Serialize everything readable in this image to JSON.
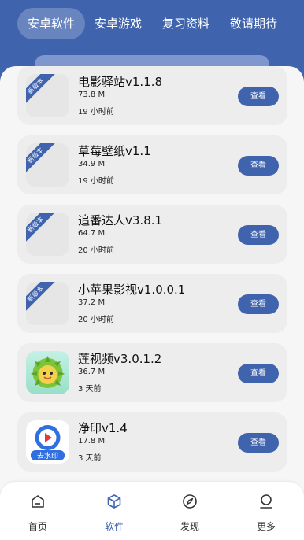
{
  "top_tabs": [
    {
      "label": "安卓软件",
      "active": true
    },
    {
      "label": "安卓游戏",
      "active": false
    },
    {
      "label": "复习资料",
      "active": false
    },
    {
      "label": "敬请期待",
      "active": false
    }
  ],
  "apps": [
    {
      "name": "电影驿站v1.1.8",
      "size": "73.8 M",
      "time": "19 小时前",
      "badge": "新版本",
      "button": "查看",
      "icon": "placeholder"
    },
    {
      "name": "草莓壁纸v1.1",
      "size": "34.9 M",
      "time": "19 小时前",
      "badge": "新版本",
      "button": "查看",
      "icon": "placeholder"
    },
    {
      "name": "追番达人v3.8.1",
      "size": "64.7 M",
      "time": "20 小时前",
      "badge": "新版本",
      "button": "查看",
      "icon": "placeholder"
    },
    {
      "name": "小苹果影视v1.0.0.1",
      "size": "37.2 M",
      "time": "20 小时前",
      "badge": "新版本",
      "button": "查看",
      "icon": "placeholder"
    },
    {
      "name": "莲视频v3.0.1.2",
      "size": "36.7 M",
      "time": "3 天前",
      "button": "查看",
      "icon": "lianshipin-icon"
    },
    {
      "name": "净印v1.4",
      "size": "17.8 M",
      "time": "3 天前",
      "button": "查看",
      "icon": "jingyin-icon",
      "icon_caption": "去水印"
    }
  ],
  "bottom_nav": [
    {
      "label": "首页",
      "icon": "home-icon",
      "active": false
    },
    {
      "label": "软件",
      "icon": "box-icon",
      "active": true
    },
    {
      "label": "发现",
      "icon": "compass-icon",
      "active": false
    },
    {
      "label": "更多",
      "icon": "user-icon",
      "active": false
    }
  ],
  "colors": {
    "primary": "#3f63ad",
    "card": "#ededee",
    "background": "#f6f6f7"
  }
}
